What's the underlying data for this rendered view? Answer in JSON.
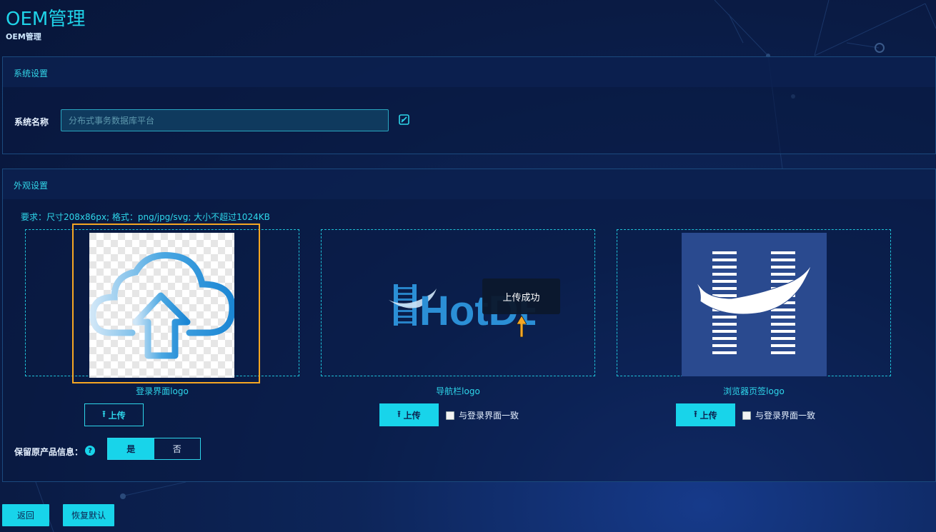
{
  "page": {
    "title": "OEM管理",
    "breadcrumb": "OEM管理"
  },
  "system_panel": {
    "header": "系统设置",
    "name_label": "系统名称",
    "name_placeholder": "分布式事务数据库平台",
    "name_value": ""
  },
  "appearance_panel": {
    "header": "外观设置",
    "requirement": "要求：尺寸208x86px; 格式：png/jpg/svg; 大小不超过1024KB",
    "logos": [
      {
        "caption": "登录界面logo",
        "upload_label": "上传",
        "checkbox_label": ""
      },
      {
        "caption": "导航栏logo",
        "upload_label": "上传",
        "checkbox_label": "与登录界面一致",
        "brand_text": "HotDB"
      },
      {
        "caption": "浏览器页签logo",
        "upload_label": "上传",
        "checkbox_label": "与登录界面一致"
      }
    ],
    "keep_info_label": "保留原产品信息：",
    "help": "?",
    "toggle": {
      "yes": "是",
      "no": "否",
      "selected": "是"
    }
  },
  "toast": "上传成功",
  "footer": {
    "back_label": "返回",
    "reset_label": "恢复默认"
  },
  "colors": {
    "accent": "#18d4ea",
    "selection_border": "#f5a623",
    "tab_logo_bg": "#2a4a8f"
  }
}
